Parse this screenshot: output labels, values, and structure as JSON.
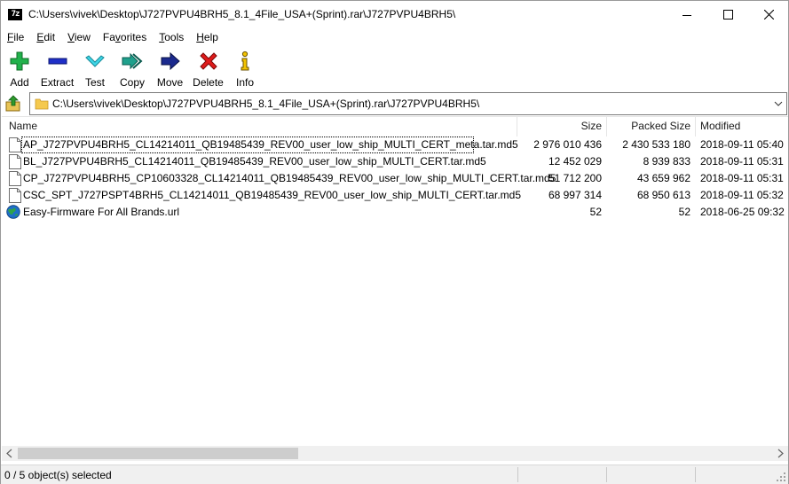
{
  "window": {
    "title": "C:\\Users\\vivek\\Desktop\\J727PVPU4BRH5_8.1_4File_USA+(Sprint).rar\\J727PVPU4BRH5\\",
    "app_icon_text": "7z",
    "minimize_icon": "minimize-icon",
    "maximize_icon": "maximize-icon",
    "close_icon": "close-icon"
  },
  "menu": [
    {
      "label": "File",
      "accel": "F",
      "rest": "ile"
    },
    {
      "label": "Edit",
      "accel": "E",
      "rest": "dit"
    },
    {
      "label": "View",
      "accel": "V",
      "rest": "iew"
    },
    {
      "label": "Favorites",
      "accel": "F",
      "rest": "avorites",
      "prefix": "Fa",
      "accel_mid": "v",
      "suffix": "orites"
    },
    {
      "label": "Tools",
      "accel": "T",
      "rest": "ools"
    },
    {
      "label": "Help",
      "accel": "H",
      "rest": "elp"
    }
  ],
  "toolbar": {
    "add": {
      "label": "Add",
      "icon": "green-plus-icon",
      "color": "#22b14c"
    },
    "extract": {
      "label": "Extract",
      "icon": "blue-minus-icon",
      "color": "#1f2fc8"
    },
    "test": {
      "label": "Test",
      "icon": "cyan-check-icon",
      "color": "#2ec5d8"
    },
    "copy": {
      "label": "Copy",
      "icon": "double-arrow-right-icon",
      "color": "#1fa08c"
    },
    "move": {
      "label": "Move",
      "icon": "arrow-right-icon",
      "color": "#1b2a8e"
    },
    "delete": {
      "label": "Delete",
      "icon": "red-x-icon",
      "color": "#e01b1b"
    },
    "info": {
      "label": "Info",
      "icon": "info-icon",
      "color": "#e0b400"
    }
  },
  "address": {
    "path": "C:\\Users\\vivek\\Desktop\\J727PVPU4BRH5_8.1_4File_USA+(Sprint).rar\\J727PVPU4BRH5\\"
  },
  "columns": {
    "name": "Name",
    "size": "Size",
    "packed": "Packed Size",
    "modified": "Modified"
  },
  "files": [
    {
      "name": "AP_J727PVPU4BRH5_CL14214011_QB19485439_REV00_user_low_ship_MULTI_CERT_meta.tar.md5",
      "size": "2 976 010 436",
      "packed": "2 430 533 180",
      "modified": "2018-09-11 05:40",
      "icon": "file-icon"
    },
    {
      "name": "BL_J727PVPU4BRH5_CL14214011_QB19485439_REV00_user_low_ship_MULTI_CERT.tar.md5",
      "size": "12 452 029",
      "packed": "8 939 833",
      "modified": "2018-09-11 05:31",
      "icon": "file-icon"
    },
    {
      "name": "CP_J727PVPU4BRH5_CP10603328_CL14214011_QB19485439_REV00_user_low_ship_MULTI_CERT.tar.md5",
      "size": "51 712 200",
      "packed": "43 659 962",
      "modified": "2018-09-11 05:31",
      "icon": "file-icon"
    },
    {
      "name": "CSC_SPT_J727PSPT4BRH5_CL14214011_QB19485439_REV00_user_low_ship_MULTI_CERT.tar.md5",
      "size": "68 997 314",
      "packed": "68 950 613",
      "modified": "2018-09-11 05:32",
      "icon": "file-icon"
    },
    {
      "name": "Easy-Firmware For All Brands.url",
      "size": "52",
      "packed": "52",
      "modified": "2018-06-25 09:32",
      "icon": "globe-icon"
    }
  ],
  "status": {
    "text": "0 / 5 object(s) selected"
  }
}
